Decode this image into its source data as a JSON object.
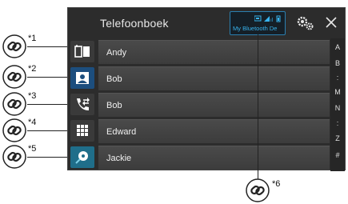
{
  "header": {
    "title": "Telefoonboek",
    "bluetooth_device": "My Bluetooth De"
  },
  "contacts": [
    {
      "name": "Andy"
    },
    {
      "name": "Bob"
    },
    {
      "name": "Bob"
    },
    {
      "name": "Edward"
    },
    {
      "name": "Jackie"
    }
  ],
  "sidebar": {
    "items": [
      {
        "icon": "phonebook-icon"
      },
      {
        "icon": "contact-card-icon"
      },
      {
        "icon": "call-history-icon"
      },
      {
        "icon": "keypad-icon"
      },
      {
        "icon": "voice-dial-icon"
      }
    ]
  },
  "index": [
    "A",
    "B",
    ":",
    "M",
    "N",
    ":",
    "Z",
    "#"
  ],
  "callouts": [
    "*1",
    "*2",
    "*3",
    "*4",
    "*5",
    "*6"
  ],
  "colors": {
    "screen_bg": "#2c2c2c",
    "row_bg": "#444444",
    "accent_blue": "#37b3ee",
    "active_sidebar": "#1c4e7e"
  }
}
